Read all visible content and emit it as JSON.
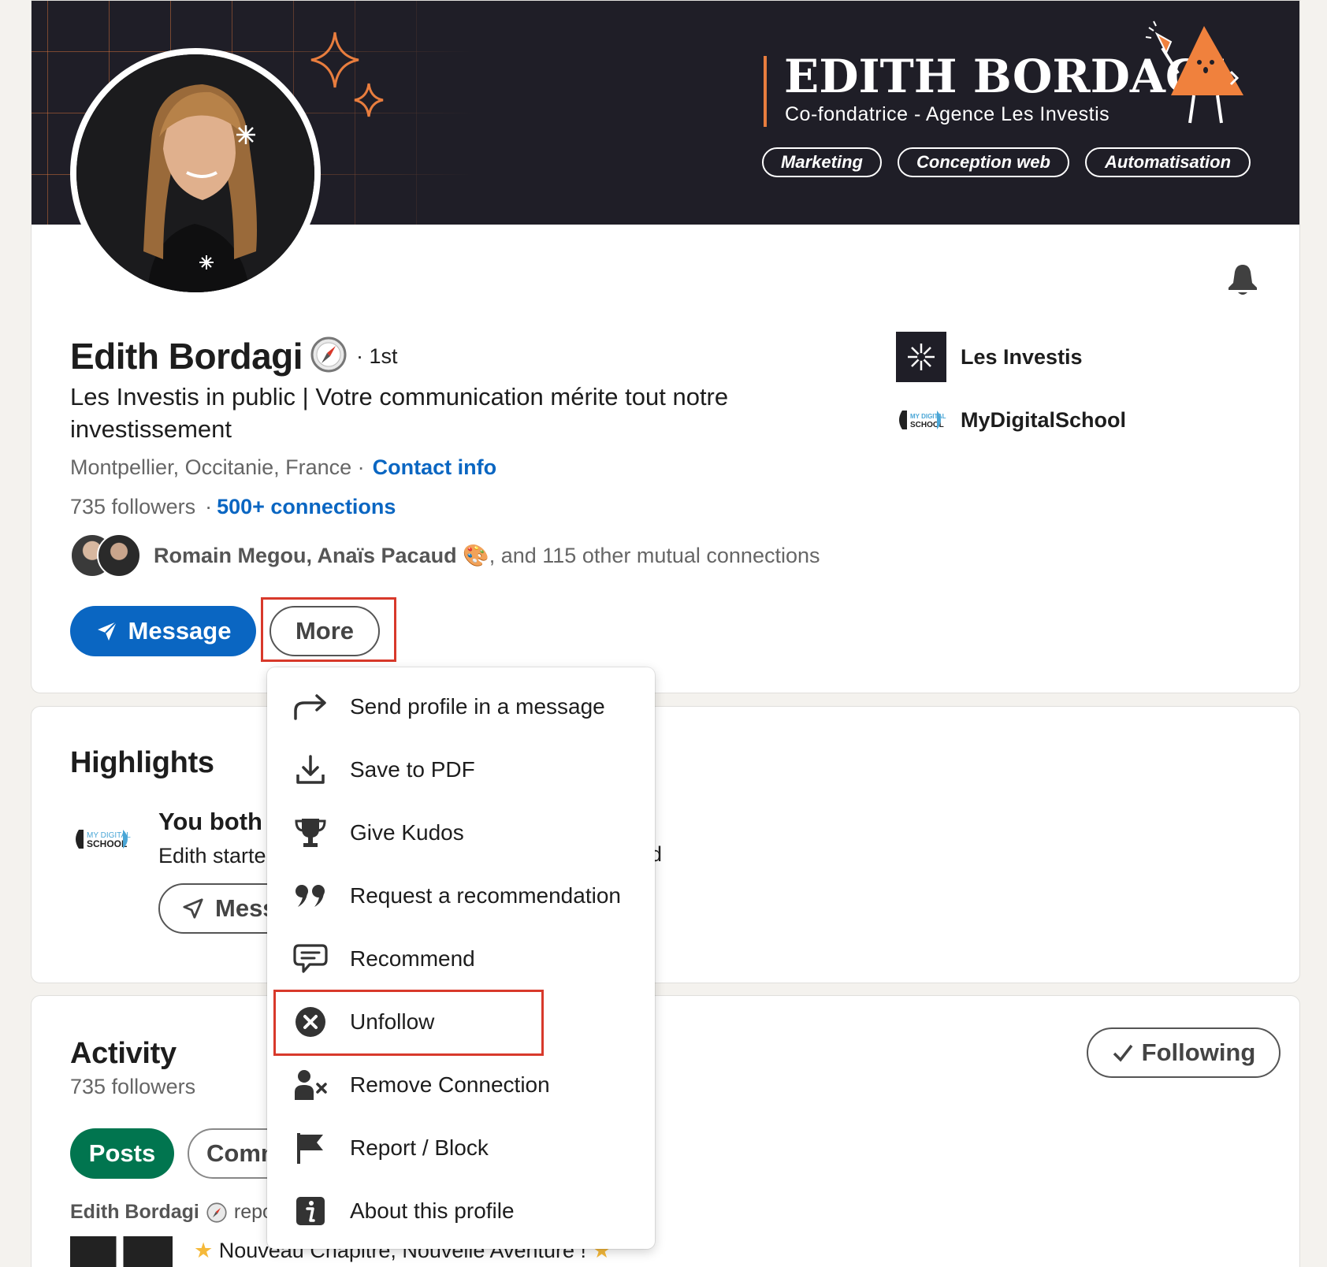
{
  "banner": {
    "name": "EDITH BORDAGI",
    "subtitle": "Co-fondatrice - Agence Les Investis",
    "tags": [
      "Marketing",
      "Conception web",
      "Automatisation"
    ]
  },
  "profile": {
    "name": "Edith Bordagi",
    "degree": "· 1st",
    "headline": "Les Investis in public | Votre communication mérite tout notre investissement",
    "location": "Montpellier, Occitanie, France ·",
    "contact_info": "Contact info",
    "followers": "735 followers",
    "dot": "·",
    "connections": "500+ connections",
    "mutual_names": "Romain Megou, Anaïs Pacaud",
    "mutual_emoji": "🎨",
    "mutual_rest": ", and 115 other mutual connections",
    "message_button": "Message",
    "more_button": "More"
  },
  "companies": [
    {
      "name": "Les Investis"
    },
    {
      "name": "MyDigitalSchool"
    }
  ],
  "highlights": {
    "title": "Highlights",
    "item_title": "You both",
    "item_desc": "Edith starte",
    "item_tail": "d",
    "message_button": "Mess"
  },
  "activity": {
    "title": "Activity",
    "followers": "735 followers",
    "following_button": "Following",
    "tabs": [
      "Posts",
      "Comm"
    ],
    "author": "Edith Bordagi",
    "author_action": "repo",
    "post_text": "Nouveau Chapitre, Nouvelle Aventure !"
  },
  "dropdown": {
    "items": [
      {
        "label": "Send profile in a message",
        "icon": "share-arrow-icon"
      },
      {
        "label": "Save to PDF",
        "icon": "download-icon"
      },
      {
        "label": "Give Kudos",
        "icon": "trophy-icon"
      },
      {
        "label": "Request a recommendation",
        "icon": "quote-icon"
      },
      {
        "label": "Recommend",
        "icon": "speech-bubble-icon"
      },
      {
        "label": "Unfollow",
        "icon": "close-circle-icon"
      },
      {
        "label": "Remove Connection",
        "icon": "remove-person-icon"
      },
      {
        "label": "Report / Block",
        "icon": "flag-icon"
      },
      {
        "label": "About this profile",
        "icon": "info-icon"
      }
    ]
  },
  "colors": {
    "link": "#0a66c2",
    "primary_button": "#0a66c2",
    "posts_pill": "#01754f",
    "highlight_box": "#d8392b",
    "banner_bg": "#1f1e27",
    "banner_accent": "#e87d3e"
  }
}
